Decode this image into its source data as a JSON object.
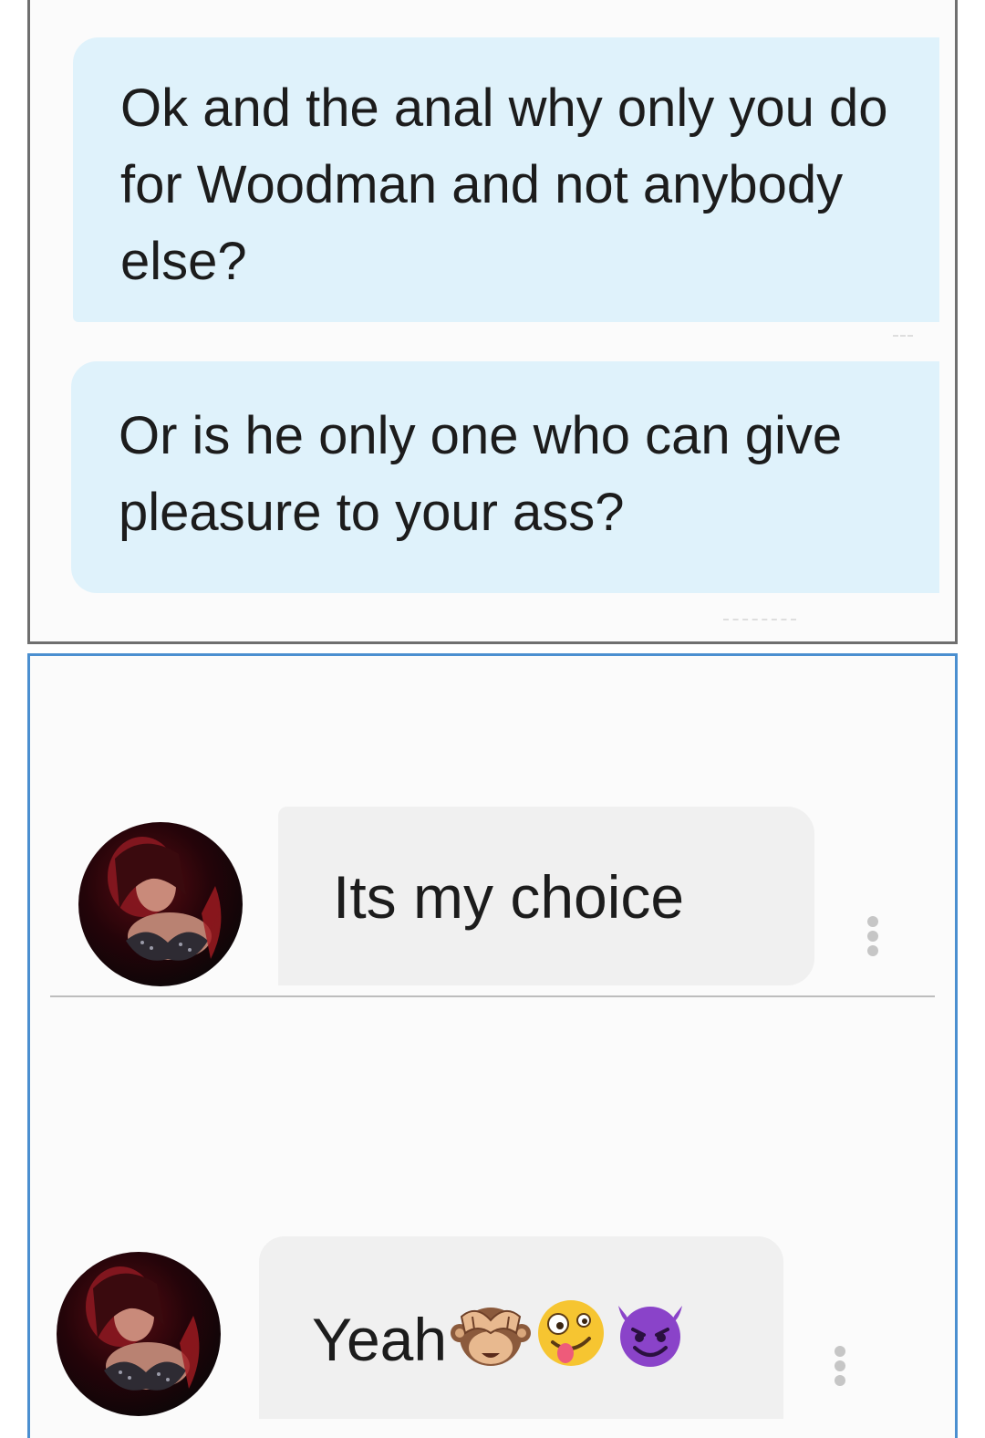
{
  "sent_messages": [
    {
      "text": "Ok and the anal why only you do for Woodman and not anybody else?"
    },
    {
      "text": "Or is he only one who can give pleasure to your ass?"
    }
  ],
  "received_messages": [
    {
      "text": "Its my choice",
      "emojis": []
    },
    {
      "text": "Yeah",
      "emojis": [
        "see-no-evil-monkey-emoji",
        "zany-face-emoji",
        "smiling-devil-emoji"
      ]
    }
  ],
  "colors": {
    "sent_bubble": "#dff2fb",
    "received_bubble": "#f0f0f0",
    "top_panel_border": "#6f6f6f",
    "bottom_panel_border": "#4b8fd0"
  },
  "icons": {
    "avatar": "contact-avatar",
    "menu": "more-vertical-icon"
  }
}
